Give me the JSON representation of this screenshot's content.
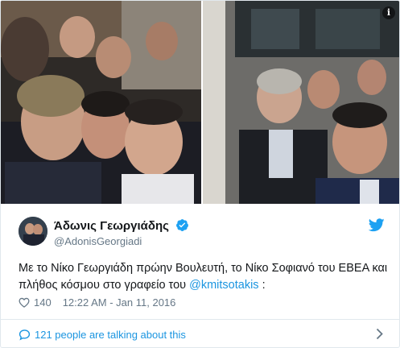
{
  "tweet": {
    "display_name": "Άδωνις Γεωργιάδης",
    "handle": "@AdonisGeorgiadi",
    "text_before_mention": "Με το Νίκο Γεωργιάδη πρώην Βουλευτή, το Νίκο Σοφιανό του ΕΒΕΑ και πλήθος κόσμου στο γραφείο του ",
    "mention": "@kmitsotakis",
    "text_after_mention": " :",
    "likes": "140",
    "timestamp": "12:22 AM - Jan 11, 2016",
    "conversation": "121 people are talking about this",
    "photo_info_glyph": "i"
  },
  "icons": {
    "verified": "verified-badge-icon",
    "brand": "twitter-bird-icon",
    "like": "heart-icon",
    "reply": "speech-bubble-icon",
    "more": "chevron-right-icon",
    "info": "info-icon"
  },
  "colors": {
    "link": "#1b95e0",
    "secondary_text": "#657786",
    "border": "#e1e8ed",
    "primary_text": "#14171a"
  }
}
